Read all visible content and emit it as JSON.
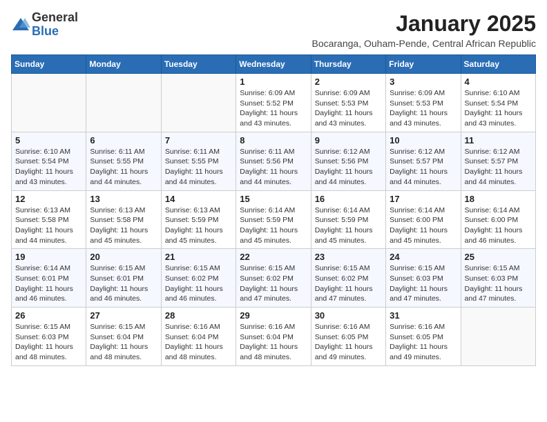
{
  "header": {
    "logo_general": "General",
    "logo_blue": "Blue",
    "month_year": "January 2025",
    "subtitle": "Bocaranga, Ouham-Pende, Central African Republic"
  },
  "weekdays": [
    "Sunday",
    "Monday",
    "Tuesday",
    "Wednesday",
    "Thursday",
    "Friday",
    "Saturday"
  ],
  "weeks": [
    [
      {
        "day": "",
        "info": ""
      },
      {
        "day": "",
        "info": ""
      },
      {
        "day": "",
        "info": ""
      },
      {
        "day": "1",
        "info": "Sunrise: 6:09 AM\nSunset: 5:52 PM\nDaylight: 11 hours and 43 minutes."
      },
      {
        "day": "2",
        "info": "Sunrise: 6:09 AM\nSunset: 5:53 PM\nDaylight: 11 hours and 43 minutes."
      },
      {
        "day": "3",
        "info": "Sunrise: 6:09 AM\nSunset: 5:53 PM\nDaylight: 11 hours and 43 minutes."
      },
      {
        "day": "4",
        "info": "Sunrise: 6:10 AM\nSunset: 5:54 PM\nDaylight: 11 hours and 43 minutes."
      }
    ],
    [
      {
        "day": "5",
        "info": "Sunrise: 6:10 AM\nSunset: 5:54 PM\nDaylight: 11 hours and 43 minutes."
      },
      {
        "day": "6",
        "info": "Sunrise: 6:11 AM\nSunset: 5:55 PM\nDaylight: 11 hours and 44 minutes."
      },
      {
        "day": "7",
        "info": "Sunrise: 6:11 AM\nSunset: 5:55 PM\nDaylight: 11 hours and 44 minutes."
      },
      {
        "day": "8",
        "info": "Sunrise: 6:11 AM\nSunset: 5:56 PM\nDaylight: 11 hours and 44 minutes."
      },
      {
        "day": "9",
        "info": "Sunrise: 6:12 AM\nSunset: 5:56 PM\nDaylight: 11 hours and 44 minutes."
      },
      {
        "day": "10",
        "info": "Sunrise: 6:12 AM\nSunset: 5:57 PM\nDaylight: 11 hours and 44 minutes."
      },
      {
        "day": "11",
        "info": "Sunrise: 6:12 AM\nSunset: 5:57 PM\nDaylight: 11 hours and 44 minutes."
      }
    ],
    [
      {
        "day": "12",
        "info": "Sunrise: 6:13 AM\nSunset: 5:58 PM\nDaylight: 11 hours and 44 minutes."
      },
      {
        "day": "13",
        "info": "Sunrise: 6:13 AM\nSunset: 5:58 PM\nDaylight: 11 hours and 45 minutes."
      },
      {
        "day": "14",
        "info": "Sunrise: 6:13 AM\nSunset: 5:59 PM\nDaylight: 11 hours and 45 minutes."
      },
      {
        "day": "15",
        "info": "Sunrise: 6:14 AM\nSunset: 5:59 PM\nDaylight: 11 hours and 45 minutes."
      },
      {
        "day": "16",
        "info": "Sunrise: 6:14 AM\nSunset: 5:59 PM\nDaylight: 11 hours and 45 minutes."
      },
      {
        "day": "17",
        "info": "Sunrise: 6:14 AM\nSunset: 6:00 PM\nDaylight: 11 hours and 45 minutes."
      },
      {
        "day": "18",
        "info": "Sunrise: 6:14 AM\nSunset: 6:00 PM\nDaylight: 11 hours and 46 minutes."
      }
    ],
    [
      {
        "day": "19",
        "info": "Sunrise: 6:14 AM\nSunset: 6:01 PM\nDaylight: 11 hours and 46 minutes."
      },
      {
        "day": "20",
        "info": "Sunrise: 6:15 AM\nSunset: 6:01 PM\nDaylight: 11 hours and 46 minutes."
      },
      {
        "day": "21",
        "info": "Sunrise: 6:15 AM\nSunset: 6:02 PM\nDaylight: 11 hours and 46 minutes."
      },
      {
        "day": "22",
        "info": "Sunrise: 6:15 AM\nSunset: 6:02 PM\nDaylight: 11 hours and 47 minutes."
      },
      {
        "day": "23",
        "info": "Sunrise: 6:15 AM\nSunset: 6:02 PM\nDaylight: 11 hours and 47 minutes."
      },
      {
        "day": "24",
        "info": "Sunrise: 6:15 AM\nSunset: 6:03 PM\nDaylight: 11 hours and 47 minutes."
      },
      {
        "day": "25",
        "info": "Sunrise: 6:15 AM\nSunset: 6:03 PM\nDaylight: 11 hours and 47 minutes."
      }
    ],
    [
      {
        "day": "26",
        "info": "Sunrise: 6:15 AM\nSunset: 6:03 PM\nDaylight: 11 hours and 48 minutes."
      },
      {
        "day": "27",
        "info": "Sunrise: 6:15 AM\nSunset: 6:04 PM\nDaylight: 11 hours and 48 minutes."
      },
      {
        "day": "28",
        "info": "Sunrise: 6:16 AM\nSunset: 6:04 PM\nDaylight: 11 hours and 48 minutes."
      },
      {
        "day": "29",
        "info": "Sunrise: 6:16 AM\nSunset: 6:04 PM\nDaylight: 11 hours and 48 minutes."
      },
      {
        "day": "30",
        "info": "Sunrise: 6:16 AM\nSunset: 6:05 PM\nDaylight: 11 hours and 49 minutes."
      },
      {
        "day": "31",
        "info": "Sunrise: 6:16 AM\nSunset: 6:05 PM\nDaylight: 11 hours and 49 minutes."
      },
      {
        "day": "",
        "info": ""
      }
    ]
  ]
}
